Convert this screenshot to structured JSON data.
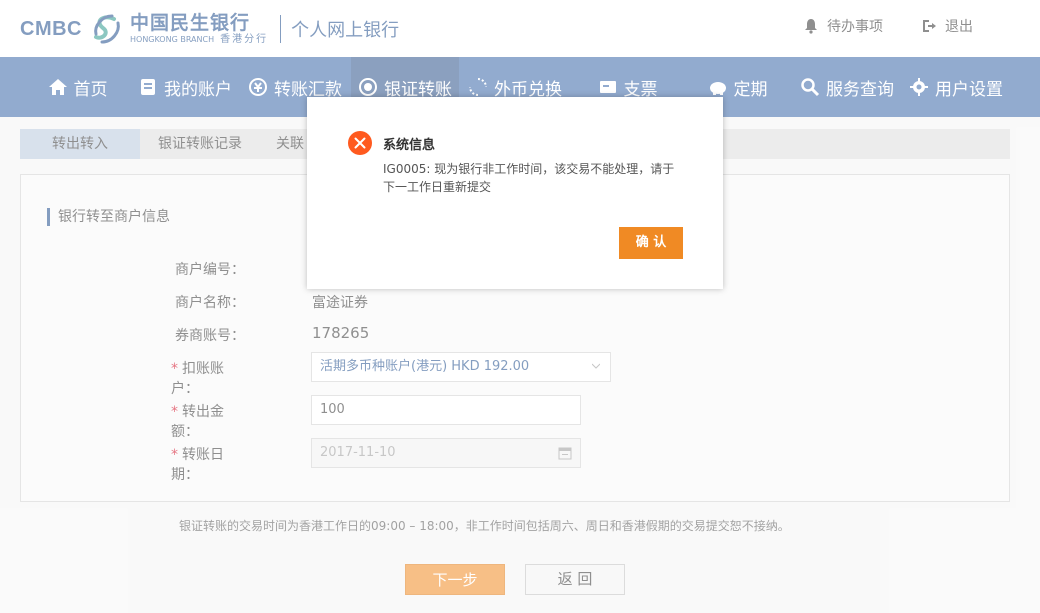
{
  "header": {
    "brand_en": "CMBC",
    "brand_cn": "中国民生银行",
    "branch_en": "HONGKONG BRANCH",
    "branch_cn": "香港分行",
    "product": "个人网上银行",
    "todo_label": "待办事项",
    "logout_label": "退出",
    "brand_color": "#1f4e8c"
  },
  "nav": {
    "items": [
      {
        "label": "首页",
        "icon": "home-icon"
      },
      {
        "label": "我的账户",
        "icon": "account-book-icon"
      },
      {
        "label": "转账汇款",
        "icon": "transfer-icon"
      },
      {
        "label": "银证转账",
        "icon": "securities-icon"
      },
      {
        "label": "外币兑换",
        "icon": "exchange-icon"
      },
      {
        "label": "支票",
        "icon": "cheque-icon"
      },
      {
        "label": "定期",
        "icon": "piggy-bank-icon"
      },
      {
        "label": "服务查询",
        "icon": "search-icon"
      },
      {
        "label": "用户设置",
        "icon": "gear-icon"
      }
    ],
    "active": "银证转账",
    "bg_color": "#3a67a8"
  },
  "subtabs": [
    "转出转入",
    "银证转账记录",
    "关联"
  ],
  "form": {
    "section_title": "银行转至商户信息",
    "merchant_no_label": "商户编号：",
    "merchant_name_label": "商户名称：",
    "merchant_name_value": "富途证券",
    "broker_account_label": "券商账号：",
    "broker_account_value": "178265",
    "debit_account_label": "扣账账户：",
    "debit_account_value": "活期多币种账户(港元) HKD 192.00",
    "amount_label": "转出金额：",
    "amount_value": "100",
    "date_label": "转账日期：",
    "date_value": "2017-11-10",
    "required_mark": "*"
  },
  "note": "银证转账的交易时间为香港工作日的09:00 – 18:00，非工作时间包括周六、周日和香港假期的交易提交恕不接纳。",
  "buttons": {
    "next": "下一步",
    "back": "返 回"
  },
  "modal": {
    "title": "系统信息",
    "message": "IG0005: 现为银行非工作时间，该交易不能处理，请于下一工作日重新提交",
    "confirm": "确 认",
    "accent": "#f08a24",
    "error_color": "#ff5a1f"
  }
}
